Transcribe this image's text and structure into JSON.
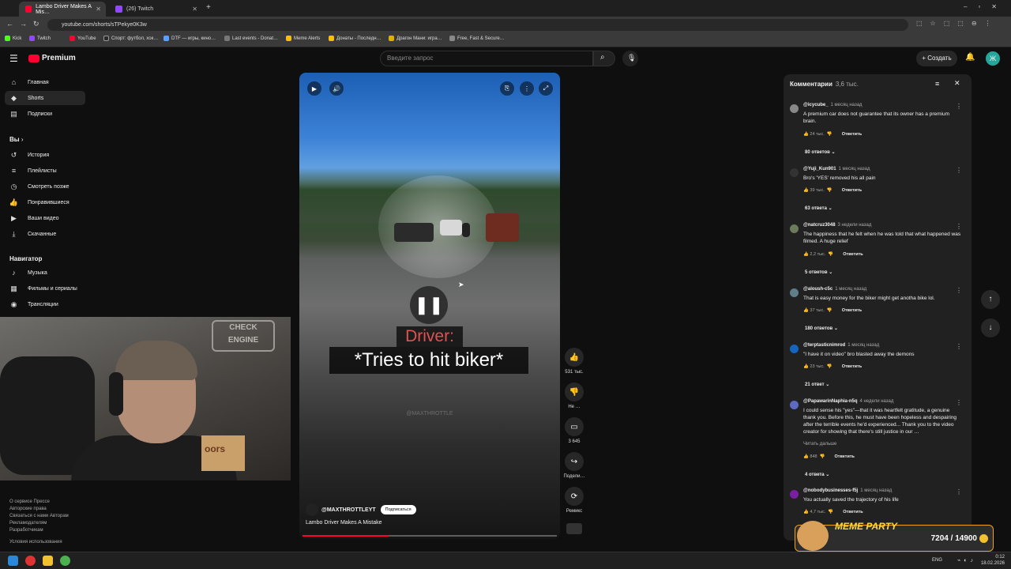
{
  "browser": {
    "tabs": [
      {
        "label": "Lambo Driver Makes A Mis…",
        "color": "#ff0033"
      },
      {
        "label": "(26) Twitch",
        "color": "#9146ff"
      }
    ],
    "url": "youtube.com/shorts/sTPekye0K3w",
    "bookmarks": [
      "Kick",
      "Twitch",
      "YouTube",
      "Спорт: футбол, хок…",
      "DTF — игры, кино…",
      "Last events - Donat…",
      "Meme Alerts",
      "Донаты - Последн…",
      "Драгон Мани: игра…",
      "Free, Fast & Secure…"
    ]
  },
  "header": {
    "logo": "Premium",
    "search_placeholder": "Введите запрос",
    "create_label": "+ Создать",
    "avatar_letter": "Ж"
  },
  "sidebar": {
    "main": [
      "Главная",
      "Shorts",
      "Подписки"
    ],
    "you_title": "Вы",
    "you": [
      "История",
      "Плейлисты",
      "Смотреть позже",
      "Понравившиеся",
      "Ваши видео",
      "Скачанные"
    ],
    "nav_title": "Навигатор",
    "nav": [
      "Музыка",
      "Фильмы и сериалы",
      "Трансляции"
    ],
    "footer1": "О сервисе  Прессе",
    "footer2": "Авторские права",
    "footer3": "Связаться с нами  Авторам",
    "footer4": "Рекламодателям",
    "footer5": "Разработчикам",
    "footer6": "Условия использования"
  },
  "video": {
    "caption_speaker": "Driver:",
    "caption_text": "*Tries to hit biker*",
    "watermark": "@MAXTHROTTLE",
    "channel": "@MAXTHROTTLEYT",
    "subscribe": "Подписаться",
    "title": "Lambo Driver Makes A Mistake",
    "progress": 0.34
  },
  "actions": {
    "likes": "531 тыс.",
    "dislike": "Не …",
    "comments": "3 645",
    "share": "Подели…",
    "remix": "Ремикс"
  },
  "comments": {
    "title": "Комментарии",
    "count": "3,6 тыс.",
    "reply_label": "Ответить",
    "items": [
      {
        "user": "@icycube_",
        "time": "1 месяц назад",
        "text": "A premium car does not guarantee that its owner has a premium brain.",
        "likes": "24 тыс.",
        "replies": "80 ответов",
        "color": "#888"
      },
      {
        "user": "@Yuji_Kun901",
        "time": "1 месяц назад",
        "text": "Bro's 'YES' removed his all pain",
        "likes": "39 тыс.",
        "replies": "63 ответа",
        "color": "#333"
      },
      {
        "user": "@natcruz3048",
        "time": "3 недели назад",
        "text": "The happiness that he felt when he was told that what happened was filmed. A huge relief",
        "likes": "2,2 тыс.",
        "replies": "5 ответов",
        "color": "#6a7a5a"
      },
      {
        "user": "@aloush-c5c",
        "time": "1 месяц назад",
        "text": "That is easy money for the biker might get anotha bike lol.",
        "likes": "37 тыс.",
        "replies": "180 ответов",
        "color": "#607d8b"
      },
      {
        "user": "@terptasticnimrod",
        "time": "1 месяц назад",
        "text": "\"I have it on video\" bro blasted away the demons",
        "likes": "23 тыс.",
        "replies": "21 ответ",
        "color": "#1565c0"
      },
      {
        "user": "@PapawarinNaphia-n5q",
        "time": "4 недели назад",
        "text": "I could sense his \"yes\"—that it was heartfelt gratitude, a genuine thank you. Before this, he must have been hopeless and despairing after the terrible events he'd experienced... Thank you to the video creator for showing that there's still justice in our …",
        "more": "Читать дальше",
        "likes": "848",
        "replies": "4 ответа",
        "color": "#5c6bc0"
      },
      {
        "user": "@nobodybusinesses-f5j",
        "time": "1 месяц назад",
        "text": "You actually saved the trajectory of his life",
        "likes": "4,7 тыс.",
        "color": "#7b1fa2"
      }
    ]
  },
  "webcam": {
    "sign_line1": "CHECK",
    "sign_line2": "ENGINE",
    "box_text": "oors"
  },
  "widget": {
    "title": "MEME PARTY",
    "counter": "7204 / 14900"
  },
  "taskbar": {
    "lang": "ENG",
    "time": "0:12",
    "date": "18.02.2026"
  }
}
